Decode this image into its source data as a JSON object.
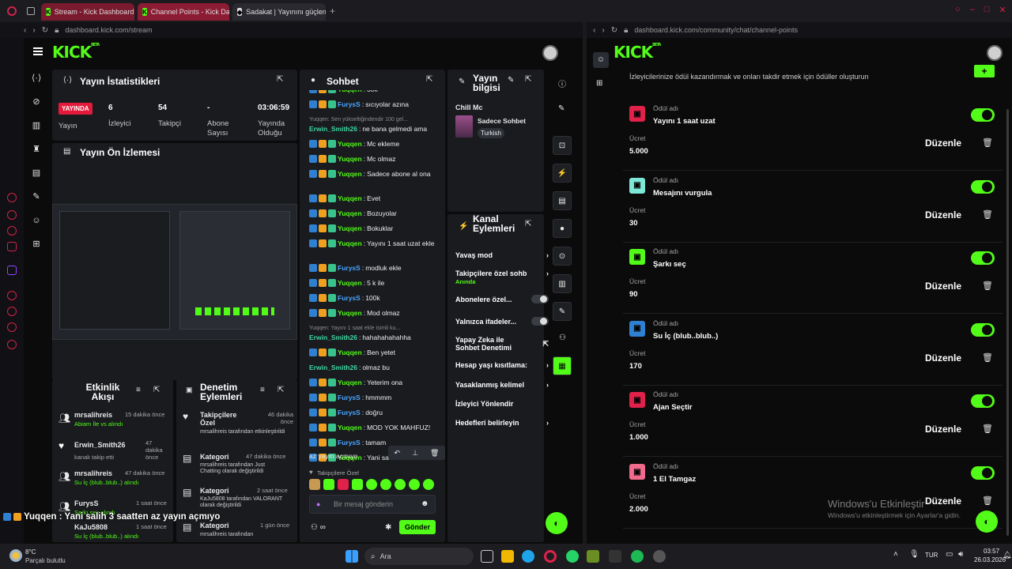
{
  "browser": {
    "tabs": [
      {
        "label": "Stream - Kick Dashboard"
      },
      {
        "label": "Channel Points - Kick Das"
      },
      {
        "label": "Sadakat | Yayınını güçlend"
      }
    ],
    "url_left": "dashboard.kick.com/stream",
    "url_right": "dashboard.kick.com/community/chat/channel-points"
  },
  "stream_stats": {
    "title": "Yayın İstatistikleri",
    "live_badge": "YAYINDA",
    "live_label": "Yayın",
    "viewers_value": "6",
    "viewers_label": "İzleyici",
    "followers_value": "54",
    "followers_label": "Takipçi",
    "subs_value": "-",
    "subs_label": "Abone Sayısı",
    "duration_value": "03:06:59",
    "duration_label": "Yayında Olduğu"
  },
  "preview": {
    "title": "Yayın Ön İzlemesi"
  },
  "activity": {
    "title": "Etkinlik Akışı",
    "items": [
      {
        "user": "mrsalihreis",
        "time": "15 dakika önce",
        "detail": "Abiam İle vs alındı"
      },
      {
        "user": "Erwin_Smith26",
        "time": "47 dakika önce",
        "detail": "kanalı takip etti"
      },
      {
        "user": "mrsalihreis",
        "time": "47 dakika önce",
        "detail": "Su İç (blub..blub..) alındı"
      },
      {
        "user": "FurysS",
        "time": "1 saat önce",
        "detail": "Şarkı seç alındı"
      },
      {
        "user": "KaJu5808",
        "time": "1 saat önce",
        "detail": "Su İç (blub..blub..) alındı"
      }
    ]
  },
  "moderation": {
    "title": "Denetim Eylemleri",
    "items": [
      {
        "title": "Takipçilere Özel",
        "time": "46 dakika önce",
        "detail": "mrsalihreis tarafından etkinleştirildi"
      },
      {
        "title": "Kategori",
        "time": "47 dakika önce",
        "detail": "mrsalihreis tarafından Just Chatting olarak değiştirildi"
      },
      {
        "title": "Kategori",
        "time": "2 saat önce",
        "detail": "KaJu5808 tarafından VALORANT olarak değiştirildi"
      },
      {
        "title": "Kategori",
        "time": "1 gün önce",
        "detail": "mrsalihreis tarafından"
      }
    ]
  },
  "chat": {
    "title": "Sohbet",
    "messages": [
      {
        "user": "Yuqqen",
        "text": "30k"
      },
      {
        "user": "FurysS",
        "text": "sıcıyolar azına"
      },
      {
        "reply": "Yuqqen: Sen yükseltiğindendir 100 gel..."
      },
      {
        "user": "Erwin_Smith26",
        "text": "ne bana gelmedi ama"
      },
      {
        "user": "Yuqqen",
        "text": "Mc ekleme"
      },
      {
        "user": "Yuqqen",
        "text": "Mc olmaz"
      },
      {
        "user": "Yuqqen",
        "text": "Sadece abone al ona"
      },
      {
        "user": "Yuqqen",
        "text": "Evet"
      },
      {
        "user": "Yuqqen",
        "text": "Bozuyolar"
      },
      {
        "user": "Yuqqen",
        "text": "Bokuklar"
      },
      {
        "user": "Yuqqen",
        "text": "Yayını 1 saat uzat ekle"
      },
      {
        "user": "FurysS",
        "text": "modluk ekle"
      },
      {
        "user": "Yuqqen",
        "text": "5 k ile"
      },
      {
        "user": "FurysS",
        "text": "100k"
      },
      {
        "user": "Yuqqen",
        "text": "Mod olmaz"
      },
      {
        "reply": "Yuqqen: Yayını 1 saat ekle isimli ku..."
      },
      {
        "user": "Erwin_Smith26",
        "text": "hahahahahahha"
      },
      {
        "user": "Yuqqen",
        "text": "Ben yetet"
      },
      {
        "user": "Erwin_Smith26",
        "text": "olmaz bu"
      },
      {
        "user": "Yuqqen",
        "text": "Yeterim ona"
      },
      {
        "user": "FurysS",
        "text": "hmmmm"
      },
      {
        "user": "FurysS",
        "text": "doğru"
      },
      {
        "user": "Yuqqen",
        "text": "MOD YOK MAHFUZ!"
      },
      {
        "user": "FurysS",
        "text": "tamam"
      },
      {
        "user": "Yuqqen",
        "text": "Yani sa"
      }
    ],
    "last_line_cont": "az yayın açmıyo",
    "followers_only": "Takipçilere Özel",
    "input_placeholder": "Bir mesaj gönderin",
    "send_label": "Gönder"
  },
  "stream_info": {
    "title": "Yayın bilgisi",
    "stream_title": "Chill Mc",
    "category": "Sadece Sohbet",
    "language": "Turkish"
  },
  "channel_actions": {
    "title": "Kanal Eylemleri",
    "items": [
      {
        "label": "Yavaş mod"
      },
      {
        "label": "Takipçilere özel sohb",
        "sub": "Anında"
      },
      {
        "label": "Abonelere özel..."
      },
      {
        "label": "Yalnızca ifadeler..."
      },
      {
        "label": "Yapay Zeka ile Sohbet Denetimi"
      },
      {
        "label": "Hesap yaşı kısıtlama:"
      },
      {
        "label": "Yasaklanmış kelimel"
      },
      {
        "label": "İzleyici Yönlendir"
      },
      {
        "label": "Hedefleri belirleyin"
      }
    ]
  },
  "overlay_caption": "Yuqqen : Yani salih 3 saatten az yayın açmıyo",
  "rewards": {
    "intro": "İzleyicilerinize ödül kazandırmak ve onları takdir etmek için ödüller oluşturun",
    "reward_label": "Ödül adı",
    "cost_label": "Ücret",
    "edit_label": "Düzenle",
    "items": [
      {
        "name": "Yayını 1 saat uzat",
        "cost": "5.000",
        "color": "#e0214a"
      },
      {
        "name": "Mesajını vurgula",
        "cost": "30",
        "color": "#7ee8d8"
      },
      {
        "name": "Şarkı seç",
        "cost": "90",
        "color": "#53fc18"
      },
      {
        "name": "Su İç (blub..blub..)",
        "cost": "170",
        "color": "#2f80d1"
      },
      {
        "name": "Ajan Seçtir",
        "cost": "1.000",
        "color": "#e0214a"
      },
      {
        "name": "1 El Tamgaz",
        "cost": "2.000",
        "color": "#f06a8c"
      }
    ]
  },
  "watermark": {
    "line1": "Windows'u Etkinleştir",
    "line2": "Windows'u etkinleştirmek için Ayarlar'a gidin."
  },
  "taskbar": {
    "weather_temp": "8°C",
    "weather_text": "Parçalı bulutlu",
    "search": "Ara",
    "lang": "TUR",
    "time": "03:57",
    "date": "26.03.2026"
  },
  "colors": {
    "kick_green": "#53fc18",
    "live_red": "#e41a3c",
    "opera_red": "#d0234a"
  }
}
